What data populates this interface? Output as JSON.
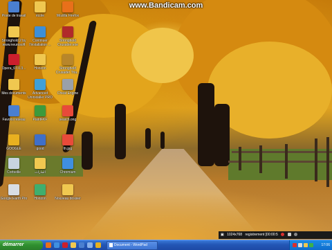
{
  "watermark": "www.Bandicam.com",
  "desktop_icons": [
    {
      "label": "Poste de travail",
      "icon": "computer-icon",
      "color": "#4a7fd0"
    },
    {
      "label": "école",
      "icon": "folder-icon",
      "color": "#f0c850"
    },
    {
      "label": "Mozilla Firefox",
      "icon": "firefox-icon",
      "color": "#e8701a"
    },
    {
      "label": "Stronghold 2 by www.neurosoft",
      "icon": "folder-icon",
      "color": "#f0c850"
    },
    {
      "label": "Continuer l'installation ...",
      "icon": "installer-icon",
      "color": "#3d8fd8"
    },
    {
      "label": "Stronghold Crusader.exe",
      "icon": "game-icon",
      "color": "#b02a2a"
    },
    {
      "label": "Opera_67.0.3...",
      "icon": "opera-icon",
      "color": "#cc1f2d"
    },
    {
      "label": "Horizon",
      "icon": "folder-icon",
      "color": "#f0c850"
    },
    {
      "label": "Stronghold Crusader Tria...",
      "icon": "game-icon",
      "color": "#b8862a"
    },
    {
      "label": "Mes documents",
      "icon": "documents-icon",
      "color": "#f0c850"
    },
    {
      "label": "Advanced Uninstaller PRO",
      "icon": "uninstaller-icon",
      "color": "#3fa0d8"
    },
    {
      "label": "Cheat Engine",
      "icon": "cheat-engine-icon",
      "color": "#9aa0a8"
    },
    {
      "label": "Favoris réseau",
      "icon": "network-icon",
      "color": "#4a7fd0"
    },
    {
      "label": "PaintFKF",
      "icon": "paint-icon",
      "color": "#3c9a3c"
    },
    {
      "label": "seaïch.ong",
      "icon": "image-file-icon",
      "color": "#e84a3a"
    },
    {
      "label": "GOOGLE",
      "icon": "chrome-icon",
      "color": "#e8b020"
    },
    {
      "label": "good",
      "icon": "image-file-icon",
      "color": "#3f6fc8"
    },
    {
      "label": "th.jpg",
      "icon": "image-file-icon",
      "color": "#e84a3a"
    },
    {
      "label": "Corbeille",
      "icon": "recycle-bin-icon",
      "color": "#c8d4e0"
    },
    {
      "label": "الماراث",
      "icon": "folder-icon",
      "color": "#f0c850"
    },
    {
      "label": "Chromium",
      "icon": "chromium-icon",
      "color": "#3f8fe0"
    },
    {
      "label": "Google Earth Pro",
      "icon": "google-earth-icon",
      "color": "#d8dde4"
    },
    {
      "label": "Horizon",
      "icon": "application-icon",
      "color": "#3fae6e"
    },
    {
      "label": "Nouveau dossier",
      "icon": "folder-icon",
      "color": "#f0c850"
    }
  ],
  "recorder": {
    "resolution": "1024x768",
    "status": "registrement [00:00:5"
  },
  "taskbar": {
    "start_label": "démarrer",
    "task_label": "Document - WordPad",
    "clock": "17:06"
  },
  "colors": {
    "taskbar": "#2356b5",
    "start": "#2f8f2f",
    "tray": "#0f6ccc"
  }
}
